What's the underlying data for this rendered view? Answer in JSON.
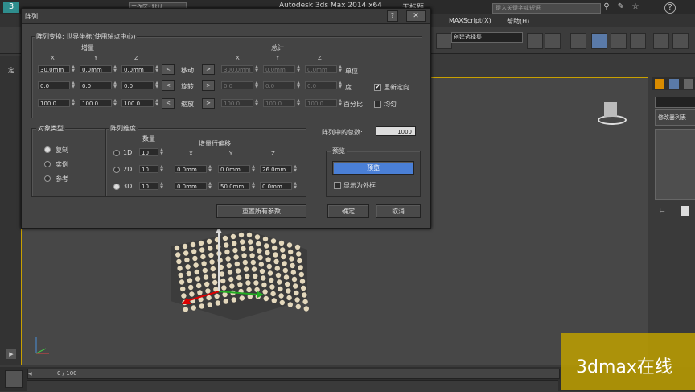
{
  "app": {
    "title": "Autodesk 3ds Max  2014 x64",
    "file": "无标题",
    "workspace": "工作区: 默认",
    "search_placeholder": "键入关键字或短语"
  },
  "menubar": {
    "items": [
      "MAXScript(X)",
      "帮助(H)"
    ]
  },
  "toolbar": {
    "selection_set": "创建选择集",
    "left_label": "定"
  },
  "command_panel": {
    "modifier_list": "修改器列表"
  },
  "timeline": {
    "frame": "0 / 100"
  },
  "watermark": "3dmax在线",
  "dialog": {
    "title": "阵列",
    "help_button": "?",
    "close_button": "✕",
    "transform_group": "阵列变换: 世界坐标(使用轴点中心)",
    "incremental_header": "增量",
    "total_header": "总计",
    "axes": [
      "X",
      "Y",
      "Z"
    ],
    "rows": [
      {
        "label": "移动",
        "inc": [
          "30.0mm",
          "0.0mm",
          "0.0mm"
        ],
        "total": [
          "300.0mm",
          "0.0mm",
          "0.0mm"
        ],
        "unit": "单位"
      },
      {
        "label": "旋转",
        "inc": [
          "0.0",
          "0.0",
          "0.0"
        ],
        "total": [
          "0.0",
          "0.0",
          "0.0"
        ],
        "unit": "度"
      },
      {
        "label": "缩放",
        "inc": [
          "100.0",
          "100.0",
          "100.0"
        ],
        "total": [
          "100.0",
          "100.0",
          "100.0"
        ],
        "unit": "百分比"
      }
    ],
    "reorient_label": "重新定向",
    "reorient_checked": true,
    "uniform_label": "均匀",
    "uniform_checked": false,
    "object_type_group": "对象类型",
    "object_types": [
      "复制",
      "实例",
      "参考"
    ],
    "object_type_selected": 0,
    "dimensions_group": "阵列维度",
    "count_header": "数量",
    "incremental_offset_header": "增量行偏移",
    "dimensions": [
      {
        "label": "1D",
        "count": "10",
        "offsets": []
      },
      {
        "label": "2D",
        "count": "10",
        "offsets": [
          "0.0mm",
          "0.0mm",
          "26.0mm"
        ]
      },
      {
        "label": "3D",
        "count": "10",
        "offsets": [
          "0.0mm",
          "50.0mm",
          "0.0mm"
        ]
      }
    ],
    "dimension_selected": 2,
    "total_in_array_label": "阵列中的总数:",
    "total_in_array": "1000",
    "preview_group": "预览",
    "preview_button": "预览",
    "display_as_box_label": "显示为外框",
    "reset_button": "重置所有参数",
    "ok_button": "确定",
    "cancel_button": "取消"
  },
  "colors": {
    "viewport_border": "#c8a000",
    "preview_button": "#4a7fd6",
    "watermark_bg": "#bea000"
  }
}
